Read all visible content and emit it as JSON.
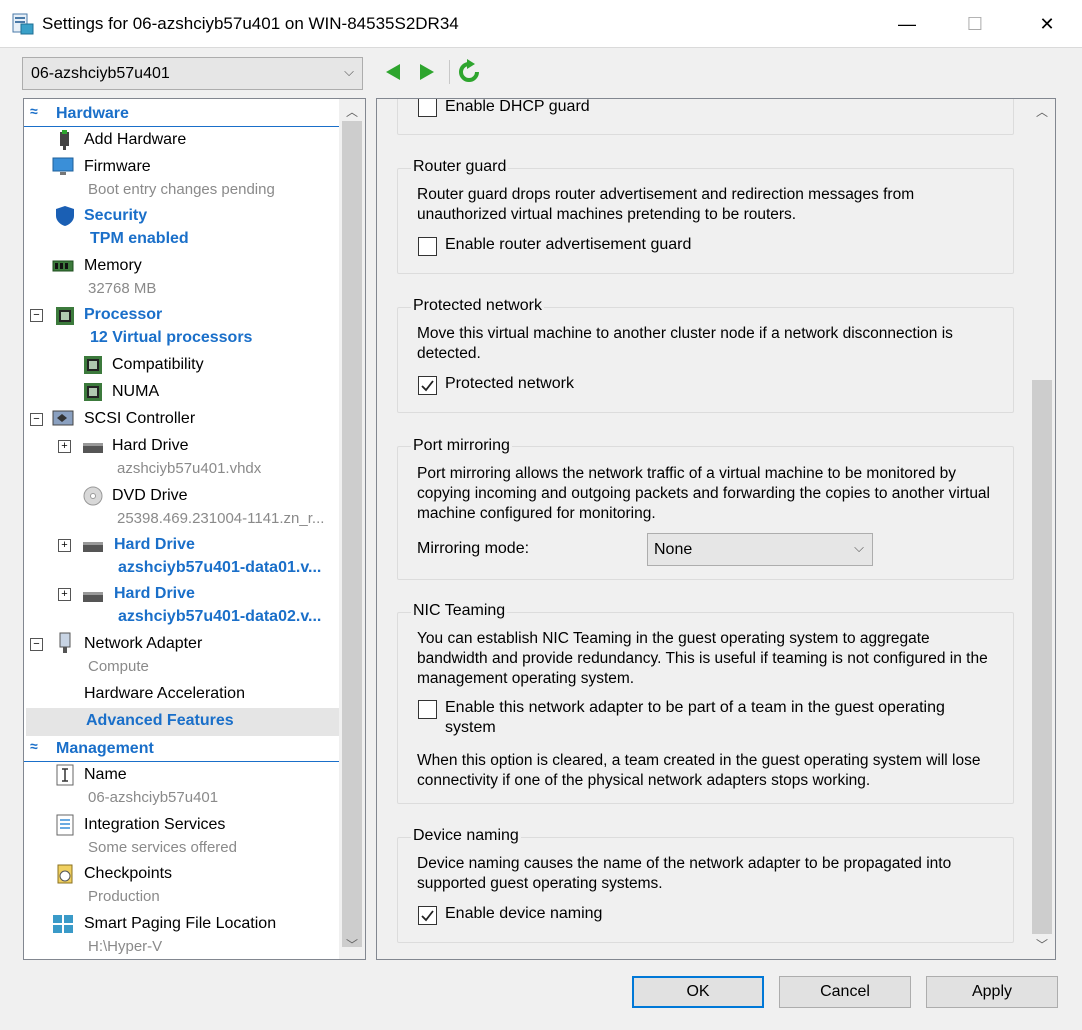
{
  "window": {
    "title": "Settings for 06-azshciyb57u401 on WIN-84535S2DR34",
    "minimize": "—",
    "maximize": "☐",
    "close": "✕"
  },
  "vm_selector": {
    "value": "06-azshciyb57u401"
  },
  "tree": {
    "hardware_header": "Hardware",
    "add_hardware": "Add Hardware",
    "firmware": "Firmware",
    "firmware_sub": "Boot entry changes pending",
    "security": "Security",
    "security_sub": "TPM enabled",
    "memory": "Memory",
    "memory_sub": "32768 MB",
    "processor": "Processor",
    "processor_sub": "12 Virtual processors",
    "compatibility": "Compatibility",
    "numa": "NUMA",
    "scsi": "SCSI Controller",
    "hd1": "Hard Drive",
    "hd1_sub": "azshciyb57u401.vhdx",
    "dvd": "DVD Drive",
    "dvd_sub": "25398.469.231004-1141.zn_r...",
    "hd2": "Hard Drive",
    "hd2_sub": "azshciyb57u401-data01.v...",
    "hd3": "Hard Drive",
    "hd3_sub": "azshciyb57u401-data02.v...",
    "network_adapter": "Network Adapter",
    "network_adapter_sub": "Compute",
    "hw_accel": "Hardware Acceleration",
    "advanced_features": "Advanced Features",
    "management_header": "Management",
    "name": "Name",
    "name_sub": "06-azshciyb57u401",
    "integration": "Integration Services",
    "integration_sub": "Some services offered",
    "checkpoints": "Checkpoints",
    "checkpoints_sub": "Production",
    "smart_paging": "Smart Paging File Location",
    "smart_paging_sub": "H:\\Hyper-V"
  },
  "panel": {
    "dhcp_guard": {
      "label": "Enable DHCP guard",
      "checked": false
    },
    "router_guard": {
      "title": "Router guard",
      "desc": "Router guard drops router advertisement and redirection messages from unauthorized virtual machines pretending to be routers.",
      "checkbox": "Enable router advertisement guard",
      "checked": false
    },
    "protected_network": {
      "title": "Protected network",
      "desc": "Move this virtual machine to another cluster node if a network disconnection is detected.",
      "checkbox": "Protected network",
      "checked": true
    },
    "port_mirroring": {
      "title": "Port mirroring",
      "desc": "Port mirroring allows the network traffic of a virtual machine to be monitored by copying incoming and outgoing packets and forwarding the copies to another virtual machine configured for monitoring.",
      "mode_label": "Mirroring mode:",
      "mode_value": "None"
    },
    "nic_teaming": {
      "title": "NIC Teaming",
      "desc": "You can establish NIC Teaming in the guest operating system to aggregate bandwidth and provide redundancy. This is useful if teaming is not configured in the management operating system.",
      "checkbox_line1": "Enable this network adapter to be part of a team in the guest operating",
      "checkbox_line2": "system",
      "checked": false,
      "note": "When this option is cleared, a team created in the guest operating system will lose connectivity if one of the physical network adapters stops working."
    },
    "device_naming": {
      "title": "Device naming",
      "desc": "Device naming causes the name of the network adapter to be propagated into supported guest operating systems.",
      "checkbox": "Enable device naming",
      "checked": true
    }
  },
  "buttons": {
    "ok": "OK",
    "cancel": "Cancel",
    "apply": "Apply"
  },
  "colors": {
    "accent": "#1a6fc9",
    "ok_border": "#0078d7",
    "nav_green": "#2ea52e"
  }
}
